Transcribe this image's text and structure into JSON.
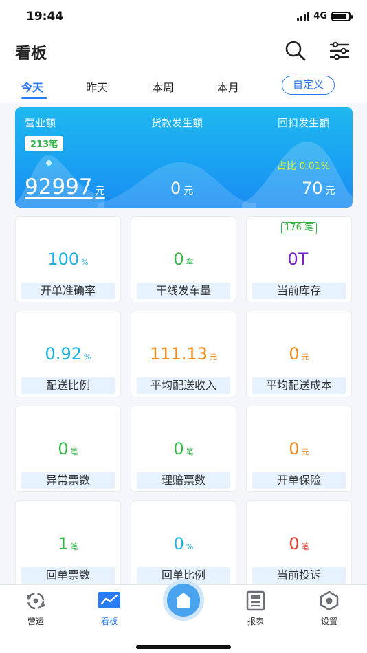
{
  "status": {
    "time": "19:44",
    "network": "4G"
  },
  "header": {
    "title": "看板"
  },
  "tabs": [
    {
      "label": "今天",
      "active": true
    },
    {
      "label": "昨天",
      "active": false
    },
    {
      "label": "本周",
      "active": false
    },
    {
      "label": "本月",
      "active": false
    }
  ],
  "custom_label": "自定义",
  "banner": {
    "revenue_label": "营业额",
    "payment_label": "货款发生额",
    "rebate_label": "回扣发生额",
    "order_count": "213笔",
    "revenue_value": "92997",
    "revenue_unit": "元",
    "payment_value": "0",
    "payment_unit": "元",
    "rebate_ratio": "占比 0.01%",
    "rebate_value": "70",
    "rebate_unit": "元"
  },
  "cards": [
    {
      "value": "100",
      "unit": "%",
      "label": "开单准确率",
      "color": "#1eb2e6"
    },
    {
      "value": "0",
      "unit": "车",
      "label": "干线发车量",
      "color": "#35b547"
    },
    {
      "value": "0T",
      "unit": "",
      "label": "当前库存",
      "color": "#7a1fc9",
      "tag": "176 笔"
    },
    {
      "value": "0.92",
      "unit": "%",
      "label": "配送比例",
      "color": "#1eb2e6"
    },
    {
      "value": "111.13",
      "unit": "元",
      "label": "平均配送收入",
      "color": "#f08a1c"
    },
    {
      "value": "0",
      "unit": "元",
      "label": "平均配送成本",
      "color": "#f08a1c"
    },
    {
      "value": "0",
      "unit": "笔",
      "label": "异常票数",
      "color": "#35b547"
    },
    {
      "value": "0",
      "unit": "笔",
      "label": "理赔票数",
      "color": "#35b547"
    },
    {
      "value": "0",
      "unit": "元",
      "label": "开单保险",
      "color": "#f08a1c"
    },
    {
      "value": "1",
      "unit": "笔",
      "label": "回单票数",
      "color": "#35b547"
    },
    {
      "value": "0",
      "unit": "%",
      "label": "回单比例",
      "color": "#1eb2e6"
    },
    {
      "value": "0",
      "unit": "笔",
      "label": "当前投诉",
      "color": "#e23b2e"
    }
  ],
  "tabbar": {
    "items": [
      {
        "label": "营运",
        "icon": "operations-icon"
      },
      {
        "label": "看板",
        "icon": "dashboard-icon",
        "active": true
      },
      {
        "label": "",
        "icon": "home-icon"
      },
      {
        "label": "报表",
        "icon": "report-icon"
      },
      {
        "label": "设置",
        "icon": "settings-icon"
      }
    ]
  },
  "colors": {
    "accent": "#2a7cf6",
    "banner": "#1aa2f2"
  }
}
